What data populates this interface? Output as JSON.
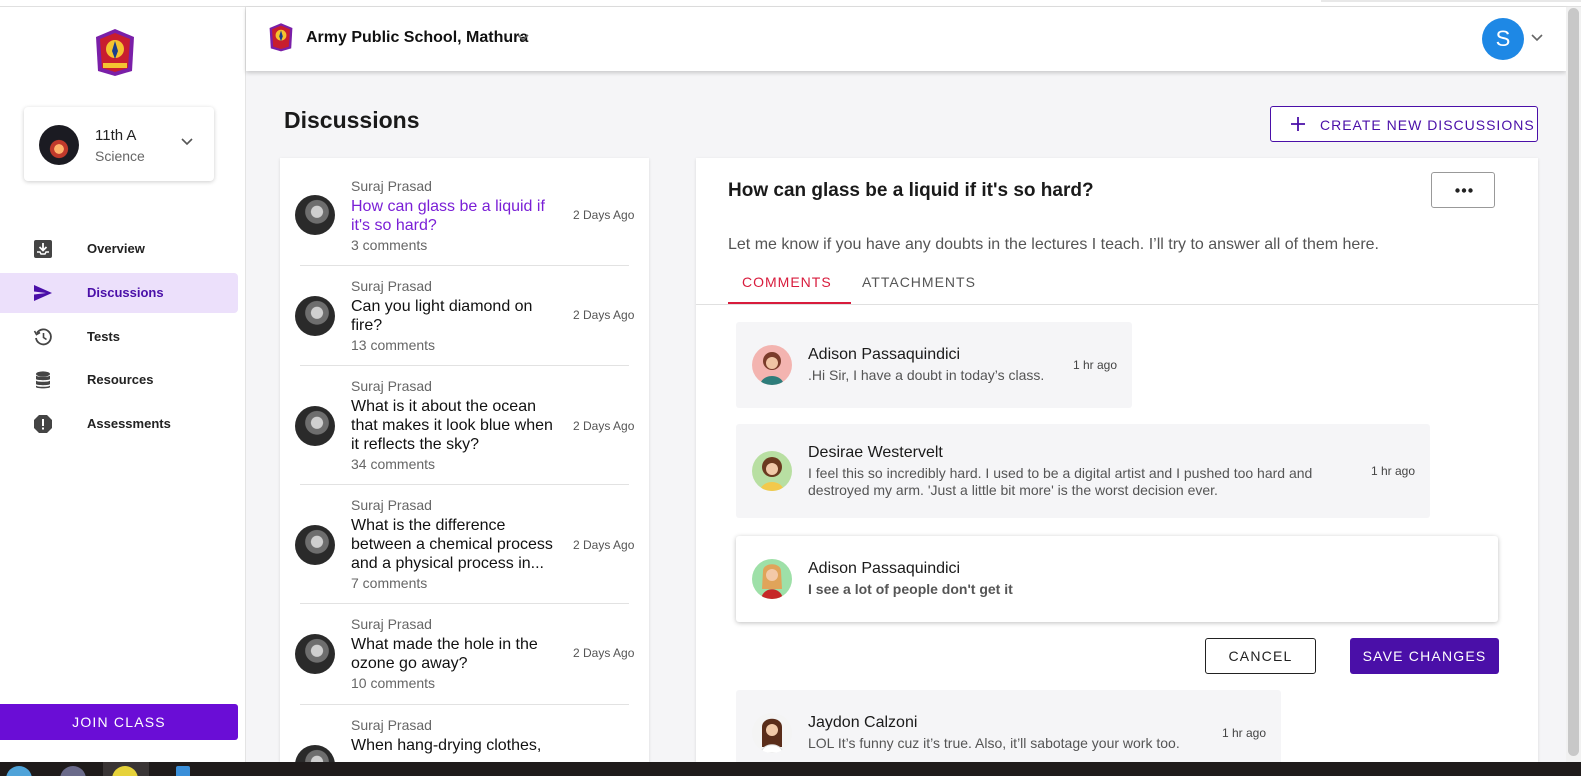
{
  "school": {
    "name": "Army Public School, Mathura"
  },
  "user": {
    "initial": "S"
  },
  "sidebar": {
    "class_card": {
      "title": "11th A",
      "subtitle": "Science"
    },
    "items": [
      {
        "label": "Overview",
        "icon": "inbox-download-icon",
        "active": false
      },
      {
        "label": "Discussions",
        "icon": "send-icon",
        "active": true
      },
      {
        "label": "Tests",
        "icon": "history-icon",
        "active": false
      },
      {
        "label": "Resources",
        "icon": "database-icon",
        "active": false
      },
      {
        "label": "Assessments",
        "icon": "alert-octagon-icon",
        "active": false
      }
    ],
    "join_button": "JOIN CLASS"
  },
  "page": {
    "title": "Discussions",
    "create_button": "CREATE NEW DISCUSSIONS"
  },
  "discussions": [
    {
      "author": "Suraj Prasad",
      "question": "How can glass be a liquid if it's so hard?",
      "comments": "3 comments",
      "when": "2 Days Ago"
    },
    {
      "author": "Suraj Prasad",
      "question": "Can you light diamond on fire?",
      "comments": "13 comments",
      "when": "2 Days Ago"
    },
    {
      "author": "Suraj Prasad",
      "question": "What is it about the ocean that makes it look blue when it reflects the sky?",
      "comments": "34 comments",
      "when": "2 Days Ago"
    },
    {
      "author": "Suraj Prasad",
      "question": "What is the difference between a chemical process and a physical process in...",
      "comments": "7 comments",
      "when": "2 Days Ago"
    },
    {
      "author": "Suraj Prasad",
      "question": "What made the hole in the ozone go away?",
      "comments": "10 comments",
      "when": "2 Days Ago"
    },
    {
      "author": "Suraj Prasad",
      "question": "When hang-drying clothes,",
      "comments": "",
      "when": ""
    }
  ],
  "detail": {
    "title": "How can glass be a liquid if it's so hard?",
    "description": "Let me know if you have any doubts in the lectures I teach. I’ll try to answer all of them here.",
    "tabs": [
      "COMMENTS",
      "ATTACHMENTS"
    ],
    "comments": [
      {
        "name": "Adison Passaquindici",
        "text": ".Hi Sir, I have a doubt in today’s class.",
        "time": "1 hr ago"
      },
      {
        "name": "Desirae Westervelt",
        "text": "I feel this so incredibly hard. I used to be a digital artist and I pushed too hard and destroyed my arm. 'Just a little bit more' is the worst decision ever.",
        "time": "1 hr ago"
      },
      {
        "name": "Adison Passaquindici",
        "text": "I see a lot of people don't get it",
        "time": ""
      },
      {
        "name": "Jaydon Calzoni",
        "text": "LOL It’s funny cuz it’s true. Also, it’ll sabotage your work too.",
        "time": "1 hr ago"
      }
    ],
    "cancel_button": "CANCEL",
    "save_button": "SAVE CHANGES"
  },
  "colors": {
    "primary": "#6a0dd6",
    "primary_dark": "#4a0fa8",
    "active_nav_bg": "#ece0fb",
    "tab_accent": "#d81b3c",
    "avatar_blue": "#1e88e5"
  }
}
